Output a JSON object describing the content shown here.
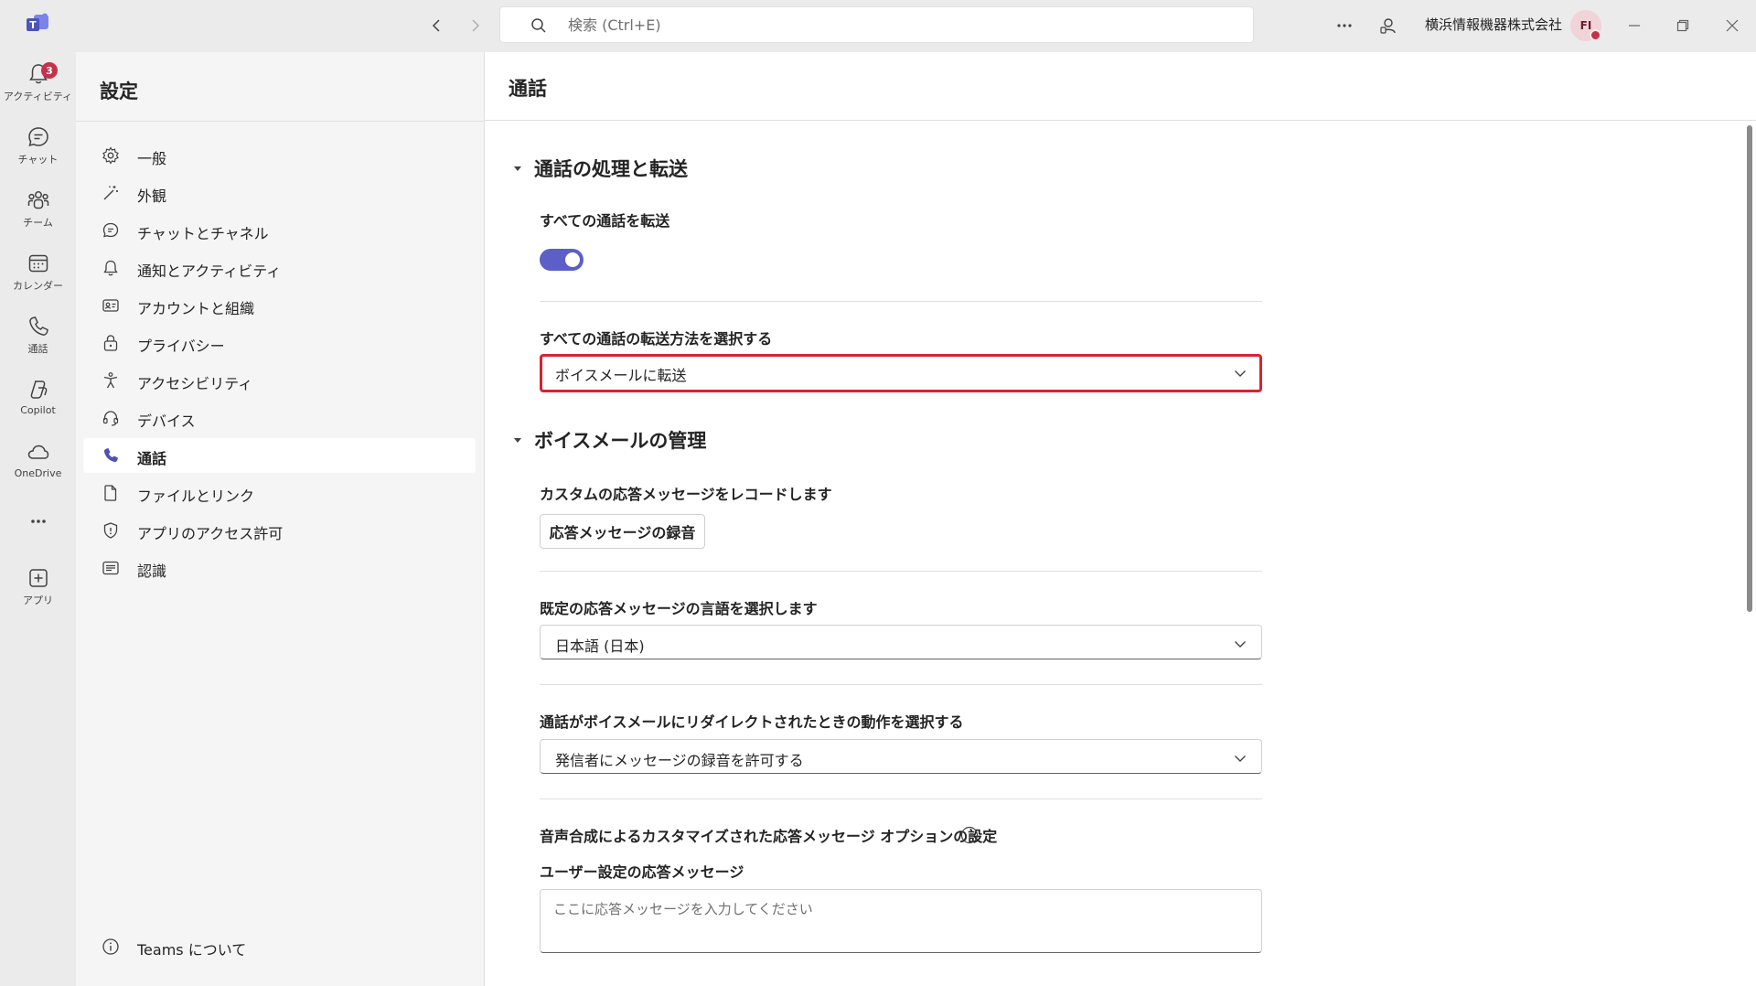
{
  "titlebar": {
    "search_placeholder": "検索 (Ctrl+E)",
    "org_name": "横浜情報機器株式会社",
    "avatar_initials": "FI",
    "more_label": "…"
  },
  "rail": {
    "items": [
      {
        "label": "アクティビティ",
        "badge": "3"
      },
      {
        "label": "チャット"
      },
      {
        "label": "チーム"
      },
      {
        "label": "カレンダー"
      },
      {
        "label": "通話"
      },
      {
        "label": "Copilot"
      },
      {
        "label": "OneDrive"
      },
      {
        "label": "アプリ"
      }
    ]
  },
  "settings": {
    "title": "設定",
    "nav": [
      {
        "label": "一般",
        "icon": "gear-icon"
      },
      {
        "label": "外観",
        "icon": "wand-icon"
      },
      {
        "label": "チャットとチャネル",
        "icon": "chat-icon"
      },
      {
        "label": "通知とアクティビティ",
        "icon": "bell-icon"
      },
      {
        "label": "アカウントと組織",
        "icon": "contact-card-icon"
      },
      {
        "label": "プライバシー",
        "icon": "lock-icon"
      },
      {
        "label": "アクセシビリティ",
        "icon": "accessibility-icon"
      },
      {
        "label": "デバイス",
        "icon": "headset-icon"
      },
      {
        "label": "通話",
        "icon": "phone-icon",
        "active": true
      },
      {
        "label": "ファイルとリンク",
        "icon": "document-icon"
      },
      {
        "label": "アプリのアクセス許可",
        "icon": "shield-icon"
      },
      {
        "label": "認識",
        "icon": "recognition-icon"
      }
    ],
    "about": "Teams について"
  },
  "main": {
    "title": "通話",
    "section1": {
      "title": "通話の処理と転送",
      "forward_all_label": "すべての通話を転送",
      "forward_all_on": true,
      "forward_method_label": "すべての通話の転送方法を選択する",
      "forward_method_value": "ボイスメールに転送"
    },
    "section2": {
      "title": "ボイスメールの管理",
      "record_label": "カスタムの応答メッセージをレコードします",
      "record_button": "応答メッセージの録音",
      "language_label": "既定の応答メッセージの言語を選択します",
      "language_value": "日本語 (日本)",
      "redirect_label": "通話がボイスメールにリダイレクトされたときの動作を選択する",
      "redirect_value": "発信者にメッセージの録音を許可する",
      "tts_label": "音声合成によるカスタマイズされた応答メッセージ オプションの設定",
      "user_greeting_label": "ユーザー設定の応答メッセージ",
      "user_greeting_placeholder": "ここに応答メッセージを入力してください"
    }
  },
  "colors": {
    "accent": "#5b5fc7",
    "highlight": "#d9232e",
    "badge": "#c4314b"
  }
}
